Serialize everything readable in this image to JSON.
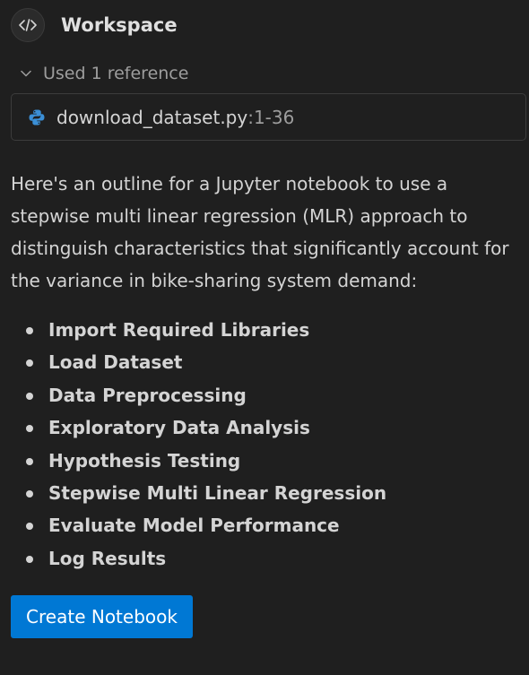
{
  "header": {
    "title": "Workspace",
    "icon": "code-brackets-icon"
  },
  "references": {
    "toggle_label": "Used 1 reference",
    "expanded": true,
    "items": [
      {
        "file": "download_dataset.py",
        "range": ":1-36",
        "icon": "python-icon"
      }
    ]
  },
  "response": {
    "intro": "Here's an outline for a Jupyter notebook to use a stepwise multi linear regression (MLR) approach to distinguish characteristics that significantly account for the variance in bike-sharing system demand:",
    "steps": [
      "Import Required Libraries",
      "Load Dataset",
      "Data Preprocessing",
      "Exploratory Data Analysis",
      "Hypothesis Testing",
      "Stepwise Multi Linear Regression",
      "Evaluate Model Performance",
      "Log Results"
    ]
  },
  "actions": {
    "create_label": "Create Notebook"
  },
  "colors": {
    "background": "#1f1f1f",
    "accent": "#0078d4",
    "text": "#d4d4d4",
    "muted": "#9d9d9d",
    "python_blue": "#3b8fd6"
  }
}
